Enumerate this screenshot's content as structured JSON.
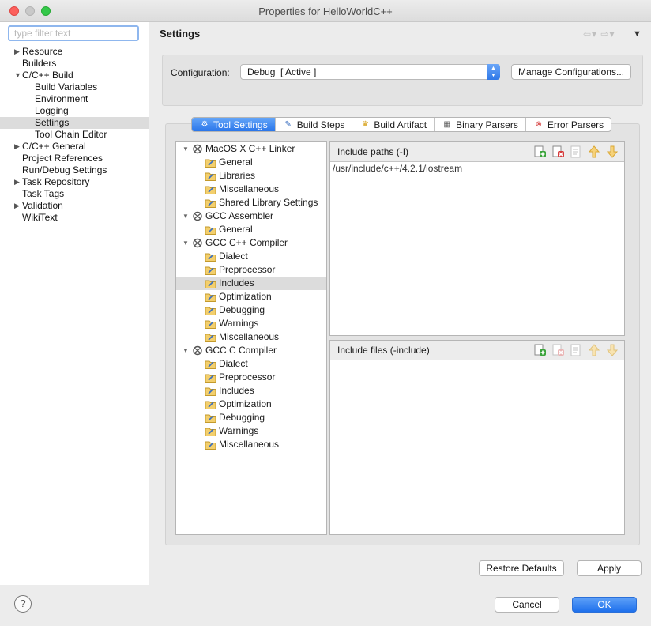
{
  "window": {
    "title": "Properties for HelloWorldC++"
  },
  "sidebar": {
    "filter_placeholder": "type filter text",
    "items": [
      {
        "label": "Resource",
        "level": 0,
        "expandable": true
      },
      {
        "label": "Builders",
        "level": 0
      },
      {
        "label": "C/C++ Build",
        "level": 0,
        "expanded": true
      },
      {
        "label": "Build Variables",
        "level": 1
      },
      {
        "label": "Environment",
        "level": 1
      },
      {
        "label": "Logging",
        "level": 1
      },
      {
        "label": "Settings",
        "level": 1,
        "selected": true
      },
      {
        "label": "Tool Chain Editor",
        "level": 1
      },
      {
        "label": "C/C++ General",
        "level": 0,
        "expandable": true
      },
      {
        "label": "Project References",
        "level": 0
      },
      {
        "label": "Run/Debug Settings",
        "level": 0
      },
      {
        "label": "Task Repository",
        "level": 0,
        "expandable": true
      },
      {
        "label": "Task Tags",
        "level": 0
      },
      {
        "label": "Validation",
        "level": 0,
        "expandable": true
      },
      {
        "label": "WikiText",
        "level": 0
      }
    ]
  },
  "main": {
    "title": "Settings",
    "configuration": {
      "label": "Configuration:",
      "value": "Debug  [ Active ]",
      "manage_label": "Manage Configurations..."
    },
    "tabs": [
      {
        "label": "Tool Settings",
        "icon": "tool-settings-icon",
        "active": true
      },
      {
        "label": "Build Steps",
        "icon": "build-steps-icon"
      },
      {
        "label": "Build Artifact",
        "icon": "build-artifact-icon"
      },
      {
        "label": "Binary Parsers",
        "icon": "binary-parsers-icon"
      },
      {
        "label": "Error Parsers",
        "icon": "error-parsers-icon"
      }
    ],
    "tool_tree": [
      {
        "label": "MacOS X C++ Linker",
        "options": [
          "General",
          "Libraries",
          "Miscellaneous",
          "Shared Library Settings"
        ]
      },
      {
        "label": "GCC Assembler",
        "options": [
          "General"
        ]
      },
      {
        "label": "GCC C++ Compiler",
        "options": [
          "Dialect",
          "Preprocessor",
          "Includes",
          "Optimization",
          "Debugging",
          "Warnings",
          "Miscellaneous"
        ]
      },
      {
        "label": "GCC C Compiler",
        "options": [
          "Dialect",
          "Preprocessor",
          "Includes",
          "Optimization",
          "Debugging",
          "Warnings",
          "Miscellaneous"
        ]
      }
    ],
    "selected_option": "GCC C++ Compiler / Includes",
    "include_paths": {
      "label": "Include paths (-I)",
      "items": [
        "/usr/include/c++/4.2.1/iostream"
      ]
    },
    "include_files": {
      "label": "Include files (-include)",
      "items": []
    },
    "restore_label": "Restore Defaults",
    "apply_label": "Apply"
  },
  "footer": {
    "help_label": "?",
    "cancel_label": "Cancel",
    "ok_label": "OK"
  },
  "colors": {
    "accent": "#2a76ea",
    "selection": "#dcdcdc",
    "panel": "#e3e3e3"
  }
}
